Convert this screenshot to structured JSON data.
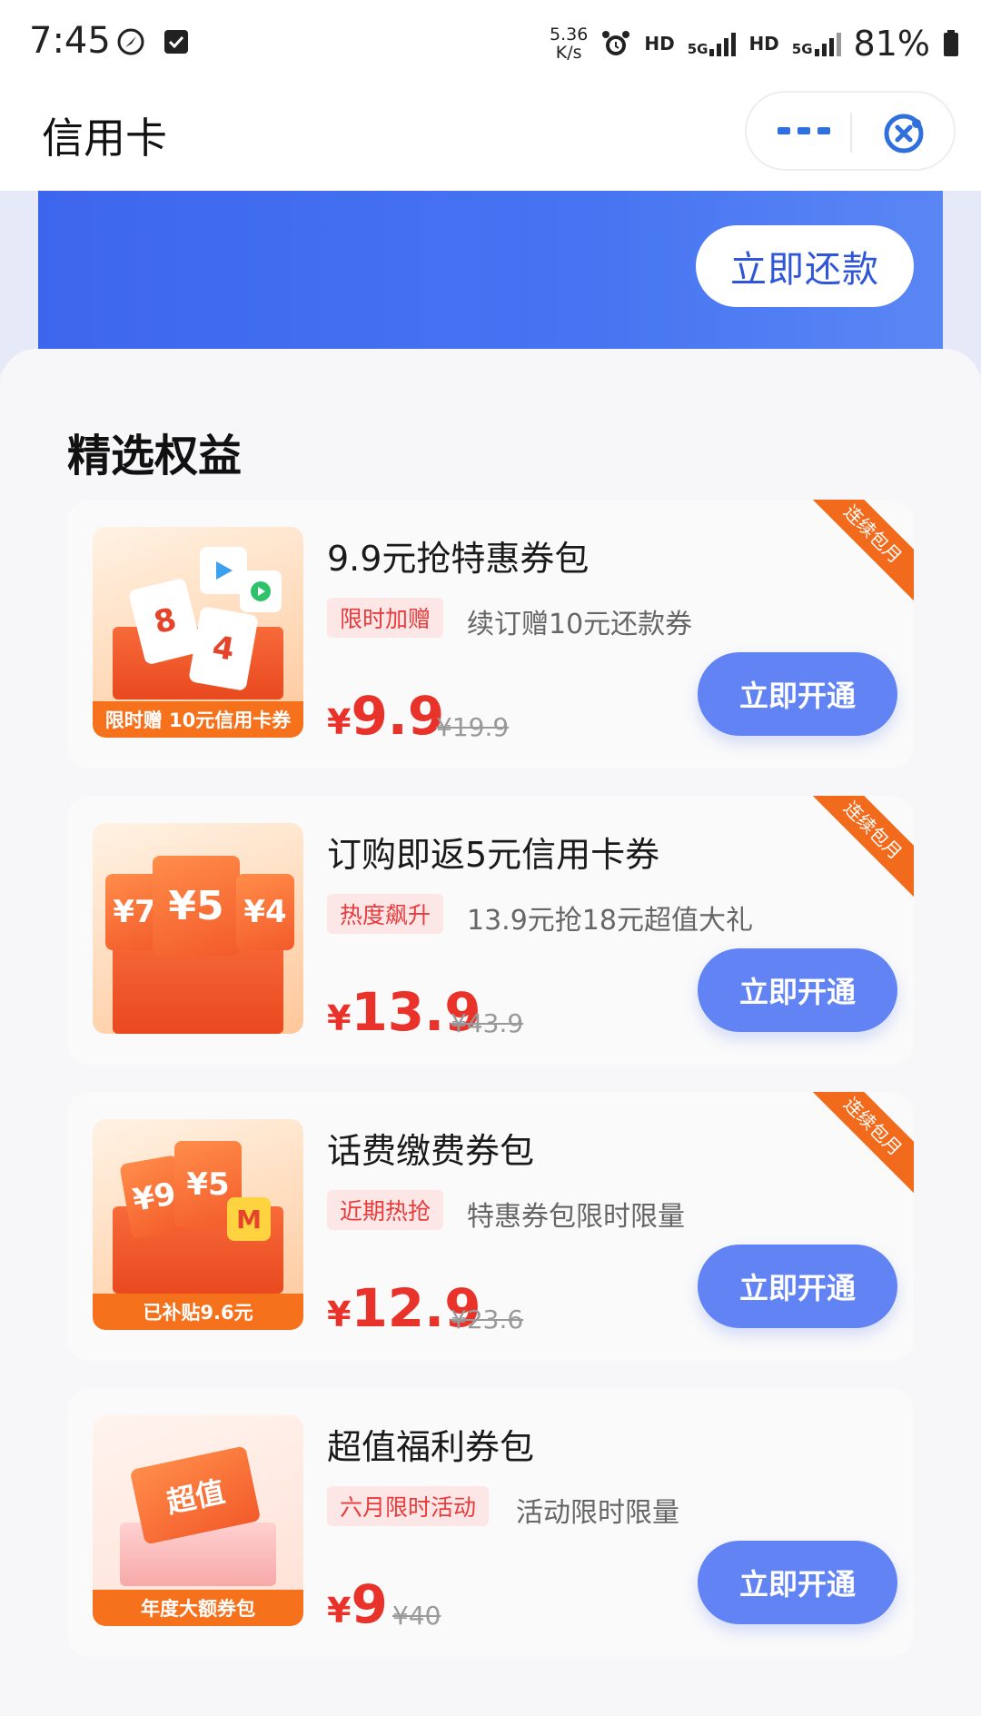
{
  "status_bar": {
    "time": "7:45",
    "speed_value": "5.36",
    "speed_unit": "K/s",
    "hd1": "HD",
    "net1": "5G",
    "hd2": "HD",
    "net2": "5G",
    "battery": "81%"
  },
  "navbar": {
    "title": "信用卡",
    "icons": [
      "more-icon",
      "mini-program-close-icon"
    ]
  },
  "banner": {
    "repay_label": "立即还款"
  },
  "benefits": {
    "section_title": "精选权益",
    "cards": [
      {
        "title": "9.9元抢特惠券包",
        "tag": "限时加赠",
        "subtitle": "续订赠10元还款券",
        "price_symbol": "¥",
        "price": "9.9",
        "original_price": "¥19.9",
        "ribbon": "连续包月",
        "thumb_label": "限时赠 10元信用卡券",
        "button_label": "立即开通"
      },
      {
        "title": "订购即返5元信用卡券",
        "tag": "热度飙升",
        "subtitle": "13.9元抢18元超值大礼",
        "price_symbol": "¥",
        "price": "13.9",
        "original_price": "¥43.9",
        "ribbon": "连续包月",
        "thumb_label": "",
        "button_label": "立即开通"
      },
      {
        "title": "话费缴费券包",
        "tag": "近期热抢",
        "subtitle": "特惠券包限时限量",
        "price_symbol": "¥",
        "price": "12.9",
        "original_price": "¥23.6",
        "ribbon": "连续包月",
        "thumb_label": "已补贴9.6元",
        "button_label": "立即开通"
      },
      {
        "title": "超值福利券包",
        "tag": "六月限时活动",
        "subtitle": "活动限时限量",
        "price_symbol": "¥",
        "price": "9",
        "original_price": "¥40",
        "ribbon": "",
        "thumb_label": "年度大额券包",
        "button_label": "立即开通"
      }
    ]
  },
  "colors": {
    "brand_blue": "#4674f2",
    "button_blue": "#6283f4",
    "price_red": "#e8322a",
    "ribbon_orange": "#f26a1b"
  }
}
